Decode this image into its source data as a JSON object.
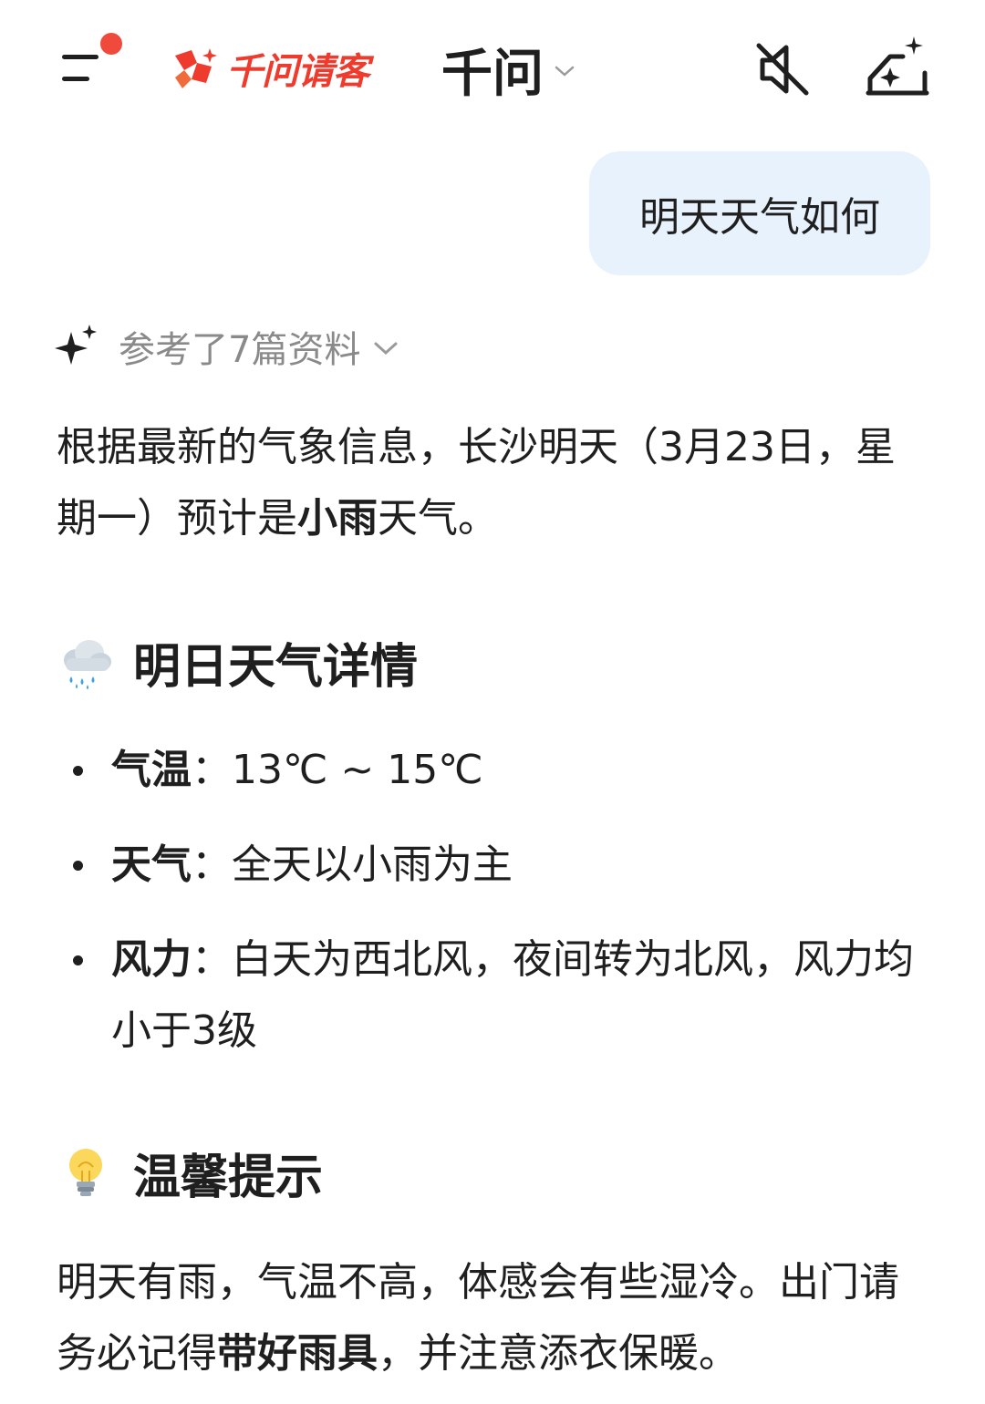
{
  "header": {
    "promo_text": "千问请客",
    "model_name": "千问",
    "icons": [
      "menu-icon",
      "mute-icon",
      "new-chat-icon"
    ],
    "accent_color": "#ef3b2d"
  },
  "user_message": "明天天气如何",
  "references": {
    "label": "参考了7篇资料"
  },
  "answer": {
    "intro_pre": "根据最新的气象信息，长沙明天（3月23日，星期一）预计是",
    "intro_bold": "小雨",
    "intro_post": "天气。",
    "section1_title": "明日天气详情",
    "section1_emoji": "rain-cloud-icon",
    "bullets": [
      {
        "label": "气温",
        "sep": "：",
        "text": "13℃ ~ 15℃"
      },
      {
        "label": "天气",
        "sep": "：",
        "text": "全天以小雨为主"
      },
      {
        "label": "风力",
        "sep": "：",
        "text": "白天为西北风，夜间转为北风，风力均小于3级"
      }
    ],
    "section2_title": "温馨提示",
    "section2_emoji": "light-bulb-icon",
    "tip_pre": "明天有雨，气温不高，体感会有些湿冷。出门请务必记得",
    "tip_bold": "带好雨具",
    "tip_post": "，并注意添衣保暖。"
  }
}
